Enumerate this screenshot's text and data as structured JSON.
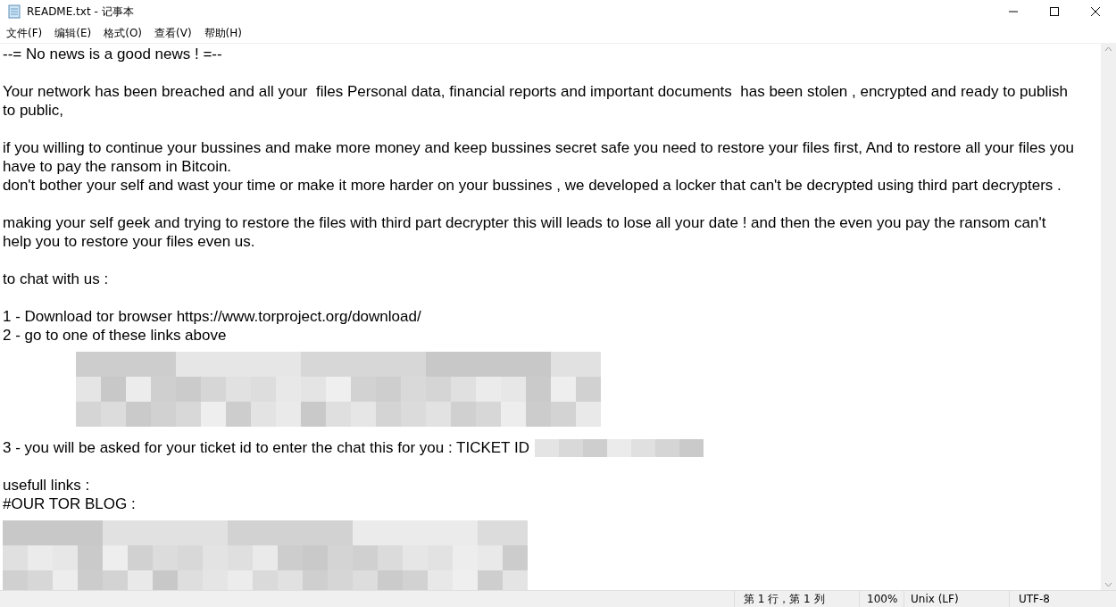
{
  "window": {
    "title": "README.txt - 记事本"
  },
  "menu": [
    "文件(F)",
    "编辑(E)",
    "格式(O)",
    "查看(V)",
    "帮助(H)"
  ],
  "lines": [
    {
      "kind": "text",
      "text": "--= No news is a good news ! =--"
    },
    {
      "kind": "blank"
    },
    {
      "kind": "text",
      "text": "Your network has been breached and all your  files Personal data, financial reports and important documents  has been stolen , encrypted and ready to publish"
    },
    {
      "kind": "text",
      "text": "to public,"
    },
    {
      "kind": "blank"
    },
    {
      "kind": "text",
      "text": "if you willing to continue your bussines and make more money and keep bussines secret safe you need to restore your files first, And to restore all your files you"
    },
    {
      "kind": "text",
      "text": "have to pay the ransom in Bitcoin."
    },
    {
      "kind": "text",
      "text": "don't bother your self and wast your time or make it more harder on your bussines , we developed a locker that can't be decrypted using third part decrypters ."
    },
    {
      "kind": "blank"
    },
    {
      "kind": "text",
      "text": "making your self geek and trying to restore the files with third part decrypter this will leads to lose all your date ! and then the even you pay the ransom can't"
    },
    {
      "kind": "text",
      "text": "help you to restore your files even us."
    },
    {
      "kind": "blank"
    },
    {
      "kind": "text",
      "text": "to chat with us :"
    },
    {
      "kind": "blank"
    },
    {
      "kind": "text",
      "text": "1 - Download tor browser https://www.torproject.org/download/"
    },
    {
      "kind": "text",
      "text": "2 - go to one of these links above"
    },
    {
      "kind": "indented-redaction"
    },
    {
      "kind": "text",
      "text": "3 - you will be asked for your ticket id to enter the chat this for you : TICKET ID",
      "redacted_tail": true
    },
    {
      "kind": "blank"
    },
    {
      "kind": "text",
      "text": "usefull links :"
    },
    {
      "kind": "text",
      "text": "#OUR TOR BLOG :"
    },
    {
      "kind": "redaction"
    }
  ],
  "status_bar": {
    "position": "第 1 行，第 1 列",
    "zoom": "100%",
    "line_ending": "Unix (LF)",
    "encoding": "UTF-8"
  }
}
